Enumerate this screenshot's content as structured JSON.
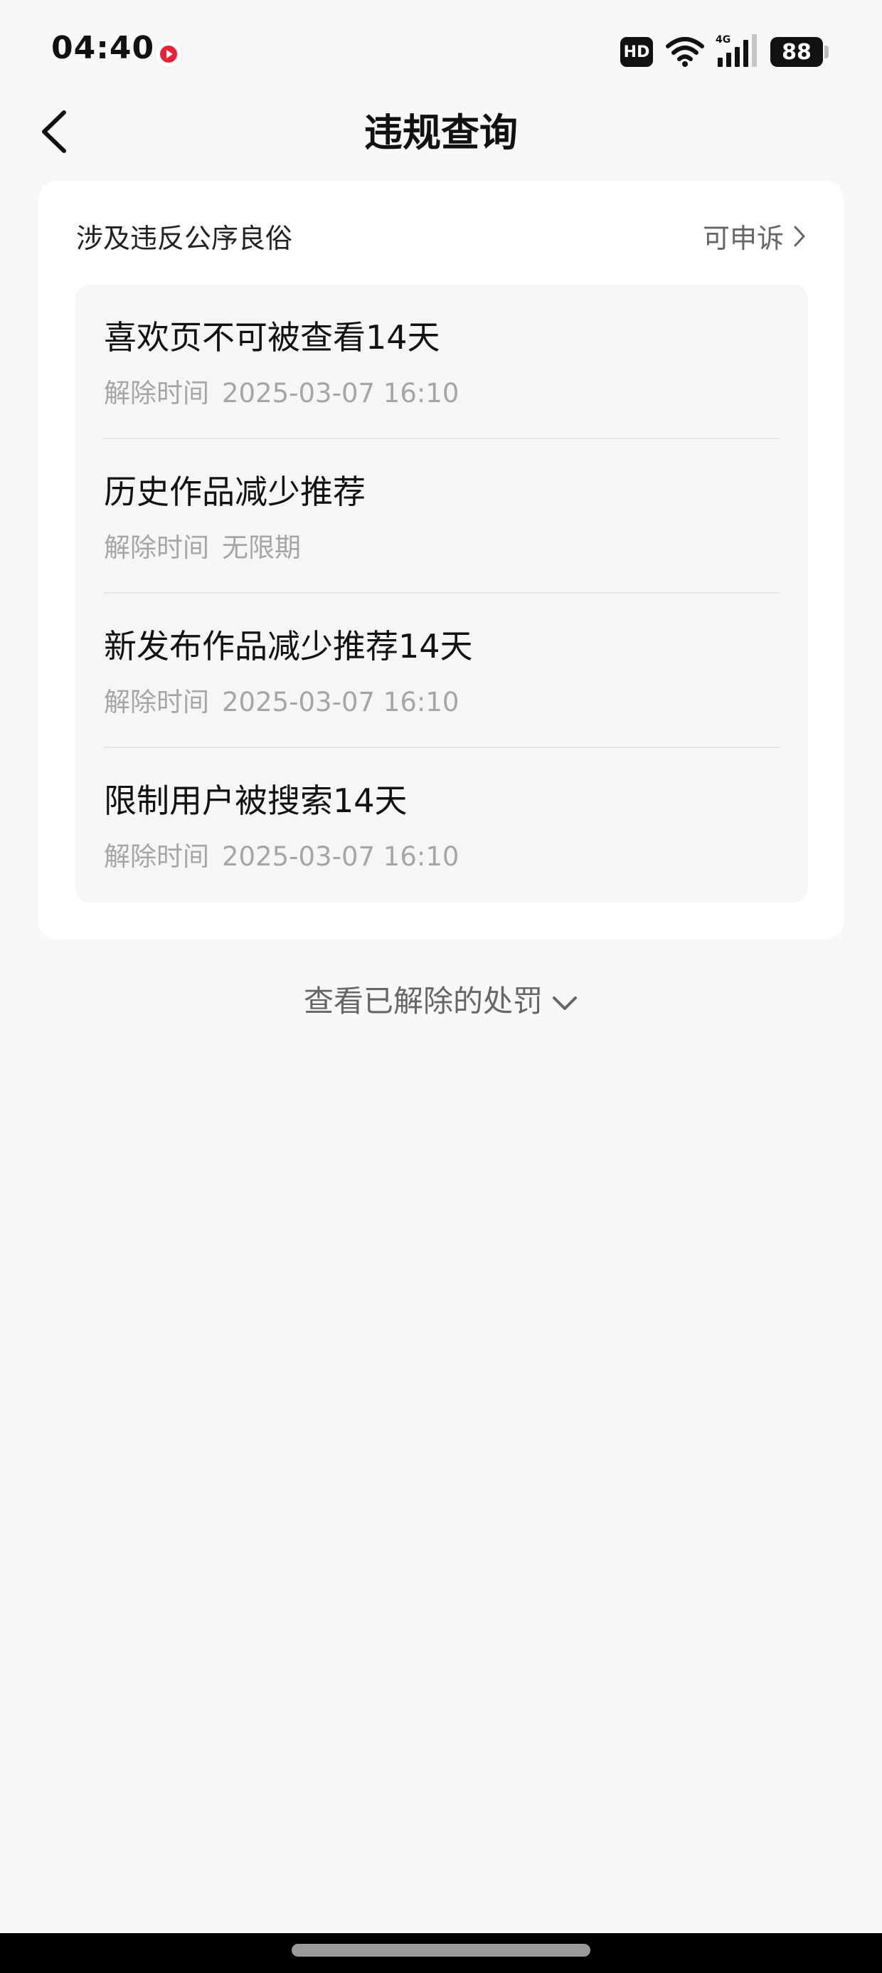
{
  "status_bar": {
    "time": "04:40",
    "hd": "HD",
    "network": "4G",
    "battery": "88",
    "icons": [
      "recording-icon",
      "wifi-icon",
      "signal-icon",
      "battery-icon"
    ]
  },
  "header": {
    "title": "违规查询",
    "back_icon": "chevron-left-icon"
  },
  "violation_card": {
    "category": "涉及违反公序良俗",
    "appeal_label": "可申诉",
    "time_label": "解除时间",
    "penalties": [
      {
        "title": "喜欢页不可被查看14天",
        "time": "2025-03-07 16:10"
      },
      {
        "title": "历史作品减少推荐",
        "time": "无限期"
      },
      {
        "title": "新发布作品减少推荐14天",
        "time": "2025-03-07 16:10"
      },
      {
        "title": "限制用户被搜索14天",
        "time": "2025-03-07 16:10"
      }
    ]
  },
  "view_removed_label": "查看已解除的处罚",
  "colors": {
    "background": "#f8f8f8",
    "card": "#ffffff",
    "penalty_box": "#f6f6f6",
    "primary_text": "#111111",
    "secondary_text": "#666666",
    "muted_text": "#a6a6a6",
    "record_red": "#ef1f38"
  }
}
